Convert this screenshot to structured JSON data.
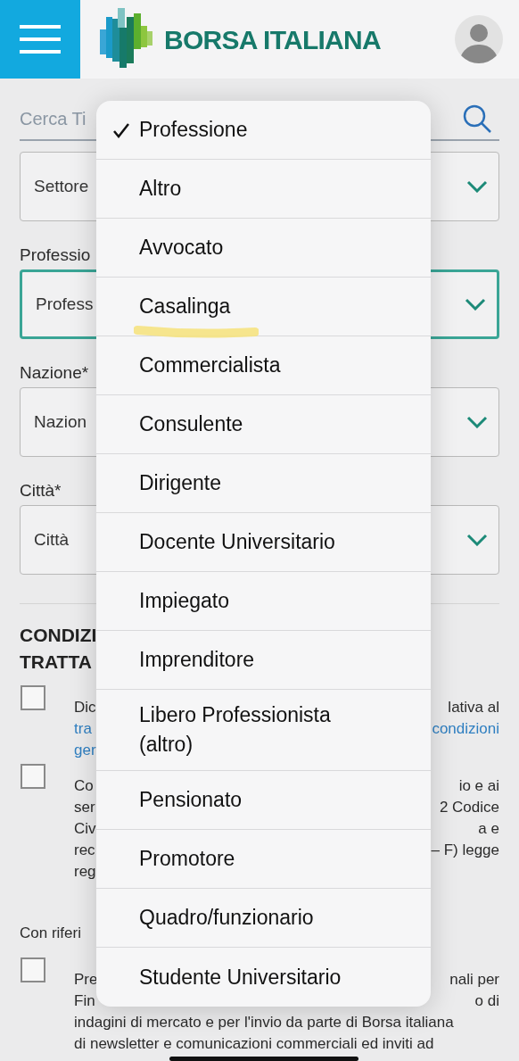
{
  "header": {
    "logo_text": "BORSA ITALIANA"
  },
  "search": {
    "placeholder": "Cerca Ti"
  },
  "form": [
    {
      "kind": "field",
      "value": "Settore",
      "focused": false
    },
    {
      "kind": "label",
      "text": "Professio"
    },
    {
      "kind": "field",
      "value": "Profess",
      "focused": true
    },
    {
      "kind": "label",
      "text": "Nazione*"
    },
    {
      "kind": "field",
      "value": "Nazion",
      "focused": false
    },
    {
      "kind": "label",
      "text": "Città*"
    },
    {
      "kind": "field",
      "value": "Città",
      "focused": false
    }
  ],
  "conditions": {
    "heading": [
      "CONDIZI",
      "TRATTA"
    ],
    "blocks": [
      {
        "checked": false,
        "lines": [
          {
            "left": "Dic",
            "right": "lativa al",
            "link": false
          },
          {
            "left": "tra",
            "right": "condizioni",
            "link": true
          },
          {
            "left": "ger",
            "link": true
          }
        ]
      },
      {
        "checked": false,
        "lines": [
          {
            "left": "Co",
            "right": "io e ai",
            "link": false
          },
          {
            "left": "ser",
            "right": "2 Codice",
            "link": false
          },
          {
            "left": "Civ",
            "right": "a e",
            "link": false
          },
          {
            "left": "rec",
            "right": "– F) legge",
            "link": false
          },
          {
            "left": "reg",
            "link": false
          }
        ]
      }
    ],
    "note": "Con riferi",
    "last_block": {
      "checked": false,
      "lines": [
        {
          "left": "Pre",
          "right": "nali per",
          "link": false
        },
        {
          "left": "Fin",
          "right": "o di",
          "link": false
        },
        {
          "text": "indagini di mercato e per l'invio da parte di Borsa italiana",
          "link": false
        },
        {
          "text": "di newsletter e comunicazioni commerciali ed inviti ad",
          "link": false
        }
      ]
    }
  },
  "menu": [
    {
      "label": "Professione",
      "selected": true
    },
    {
      "label": "Altro",
      "selected": false
    },
    {
      "label": "Avvocato",
      "selected": false
    },
    {
      "label": "Casalinga",
      "selected": false
    },
    {
      "label": "Commercialista",
      "selected": false
    },
    {
      "label": "Consulente",
      "selected": false
    },
    {
      "label": "Dirigente",
      "selected": false
    },
    {
      "label": "Docente Universitario",
      "selected": false
    },
    {
      "label": "Impiegato",
      "selected": false
    },
    {
      "label": "Imprenditore",
      "selected": false
    },
    {
      "label": "Libero Professionista (altro)",
      "selected": false
    },
    {
      "label": "Pensionato",
      "selected": false
    },
    {
      "label": "Promotore",
      "selected": false
    },
    {
      "label": "Quadro/funzionario",
      "selected": false
    },
    {
      "label": "Studente Universitario",
      "selected": false
    }
  ]
}
